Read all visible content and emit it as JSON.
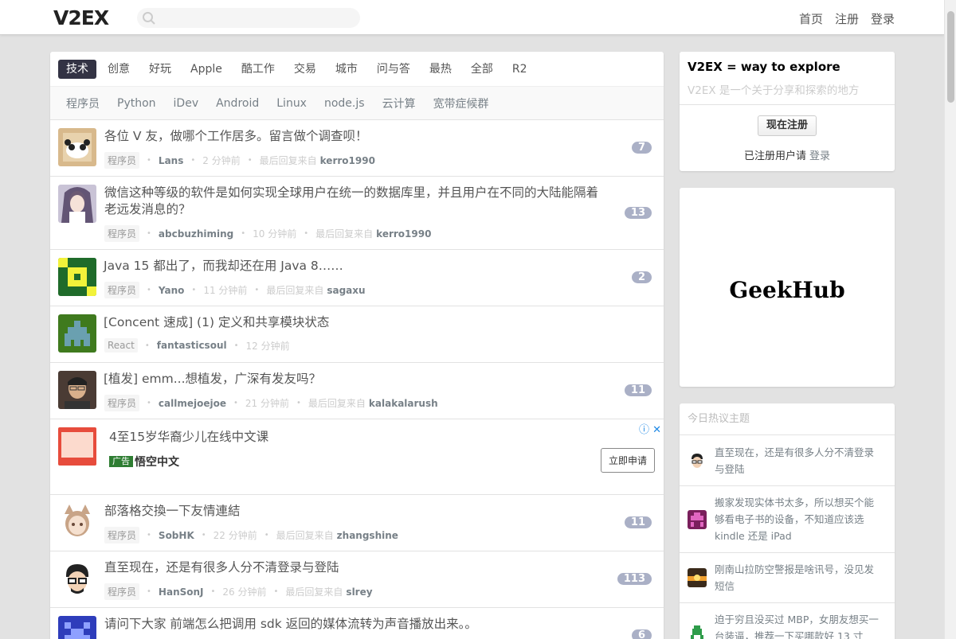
{
  "header": {
    "logo": "V2EX",
    "search_placeholder": "",
    "nav": [
      "首页",
      "注册",
      "登录"
    ]
  },
  "tabs": [
    "技术",
    "创意",
    "好玩",
    "Apple",
    "酷工作",
    "交易",
    "城市",
    "问与答",
    "最热",
    "全部",
    "R2"
  ],
  "subtabs": [
    "程序员",
    "Python",
    "iDev",
    "Android",
    "Linux",
    "node.js",
    "云计算",
    "宽带症候群"
  ],
  "topics": [
    {
      "title": "各位 V 友，做哪个工作居多。留言做个调查呗！",
      "node": "程序员",
      "author": "Lans",
      "time": "2 分钟前",
      "last_label": "最后回复来自",
      "last": "kerro1990",
      "count": "7"
    },
    {
      "title": "微信这种等级的软件是如何实现全球用户在统一的数据库里，并且用户在不同的大陆能隔着老远发消息的？",
      "node": "程序员",
      "author": "abcbuzhiming",
      "time": "10 分钟前",
      "last_label": "最后回复来自",
      "last": "kerro1990",
      "count": "13"
    },
    {
      "title": "Java 15 都出了，而我却还在用 Java 8……",
      "node": "程序员",
      "author": "Yano",
      "time": "11 分钟前",
      "last_label": "最后回复来自",
      "last": "sagaxu",
      "count": "2"
    },
    {
      "title": "[Concent 速成] (1) 定义和共享模块状态",
      "node": "React",
      "author": "fantasticsoul",
      "time": "12 分钟前",
      "last_label": "",
      "last": "",
      "count": ""
    },
    {
      "title": "[植发] emm...想植发，广深有发友吗？",
      "node": "程序员",
      "author": "callmejoejoe",
      "time": "21 分钟前",
      "last_label": "最后回复来自",
      "last": "kalakalarush",
      "count": "11"
    },
    {
      "title": "部落格交換一下友情連結",
      "node": "程序员",
      "author": "SobHK",
      "time": "22 分钟前",
      "last_label": "最后回复来自",
      "last": "zhangshine",
      "count": "11"
    },
    {
      "title": "直至现在，还是有很多人分不清登录与登陆",
      "node": "程序员",
      "author": "HanSonJ",
      "time": "26 分钟前",
      "last_label": "最后回复来自",
      "last": "slrey",
      "count": "113"
    },
    {
      "title": "请问下大家 前端怎么把调用 sdk 返回的媒体流转为声音播放出来。。",
      "node": "",
      "author": "",
      "time": "",
      "last_label": "",
      "last": "",
      "count": "6"
    }
  ],
  "ad": {
    "title": "4至15岁华裔少儿在线中文课",
    "badge": "广告",
    "brand": "悟空中文",
    "button": "立即申请",
    "icons": "ⓘ ✕"
  },
  "sidebar": {
    "intro_title": "V2EX = way to explore",
    "intro_sub": "V2EX 是一个关于分享和探索的地方",
    "register_button": "现在注册",
    "registered_text": "已注册用户请",
    "login_link": "登录",
    "sponsor": "GeekHub",
    "hot_caption": "今日热议主题",
    "hot": [
      "直至现在，还是有很多人分不清登录与登陆",
      "搬家发现实体书太多，所以想买个能够看电子书的设备，不知道应该选 kindle 还是 iPad",
      "刚南山拉防空警报是啥讯号，没见发短信",
      "迫于穷且没买过 MBP，女朋友想买一台装逼，推荐一下买哪款好 13 寸"
    ]
  }
}
